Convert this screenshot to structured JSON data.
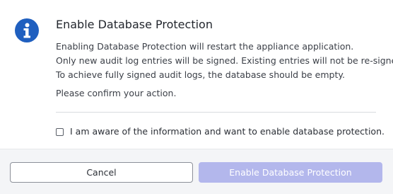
{
  "dialog": {
    "title": "Enable Database Protection",
    "icon": "info-icon",
    "icon_color": "#1f5fbf",
    "message_lines": [
      "Enabling Database Protection will restart the appliance application.",
      "Only new audit log entries will be signed. Existing entries will not be re-signed.",
      "To achieve fully signed audit logs, the database should be empty."
    ],
    "confirm_text": "Please confirm your action.",
    "acknowledge": {
      "label": "I am aware of the information and want to enable database protection.",
      "checked": false
    }
  },
  "footer": {
    "cancel_label": "Cancel",
    "confirm_label": "Enable Database Protection",
    "confirm_disabled": true,
    "confirm_color": "#b3b7ec"
  }
}
